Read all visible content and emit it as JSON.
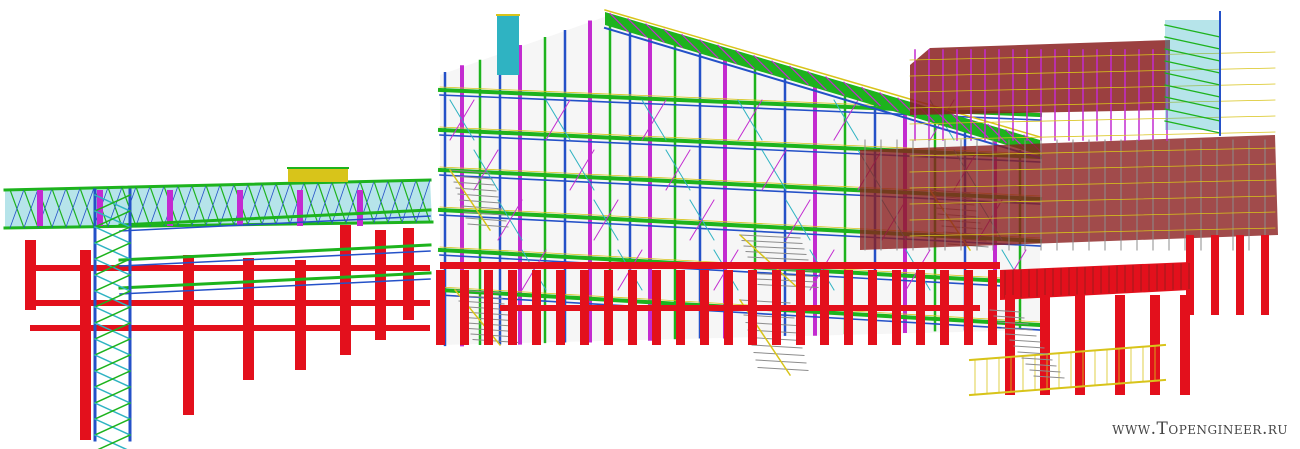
{
  "watermark": "www.Topengineer.ru",
  "palette": {
    "column": "#e3101c",
    "brace": "#1db31d",
    "beam_blue": "#2451c8",
    "beam_magenta": "#c32bd0",
    "rail_yellow": "#d8c41a",
    "roof_brown": "#8a1e1e",
    "truss_cyan": "#2fb3c2",
    "grating_gray": "#8c8c8c"
  }
}
